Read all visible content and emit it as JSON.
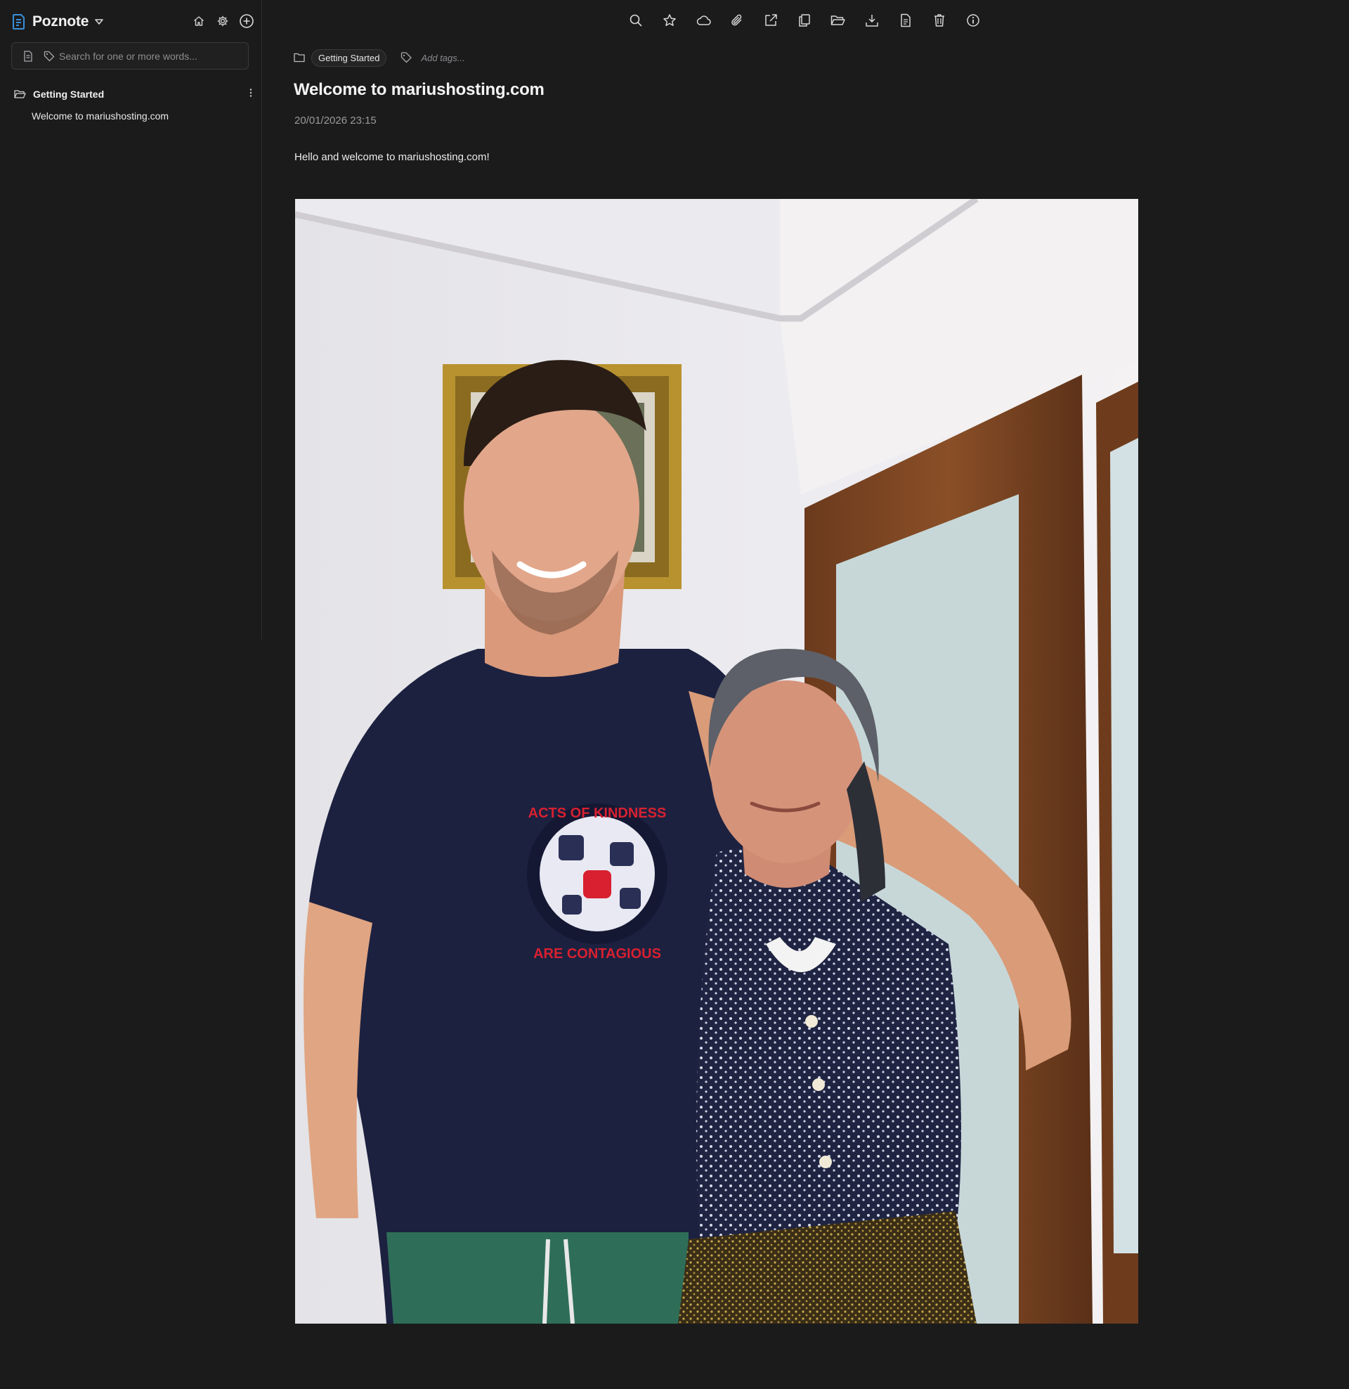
{
  "app": {
    "name": "Poznote"
  },
  "sidebar": {
    "search_placeholder": "Search for one or more words...",
    "folders": [
      {
        "name": "Getting Started",
        "notes": [
          "Welcome to mariushosting.com"
        ]
      }
    ]
  },
  "toolbar": {
    "icons": [
      "search-icon",
      "star-icon",
      "cloud-icon",
      "paperclip-icon",
      "external-link-icon",
      "duplicate-icon",
      "folder-open-icon",
      "download-icon",
      "file-icon",
      "trash-icon",
      "info-icon"
    ]
  },
  "note": {
    "folder": "Getting Started",
    "tags_placeholder": "Add tags...",
    "title": "Welcome to mariushosting.com",
    "date": "20/01/2026 23:15",
    "body": "Hello and welcome to mariushosting.com!",
    "image_shirt_text_top": "ACTS OF KINDNESS",
    "image_shirt_text_bottom": "ARE CONTAGIOUS"
  },
  "colors": {
    "background": "#1b1b1c",
    "accent": "#3a8fd9",
    "text": "#e8e8e8",
    "muted": "#9a9a9e"
  }
}
